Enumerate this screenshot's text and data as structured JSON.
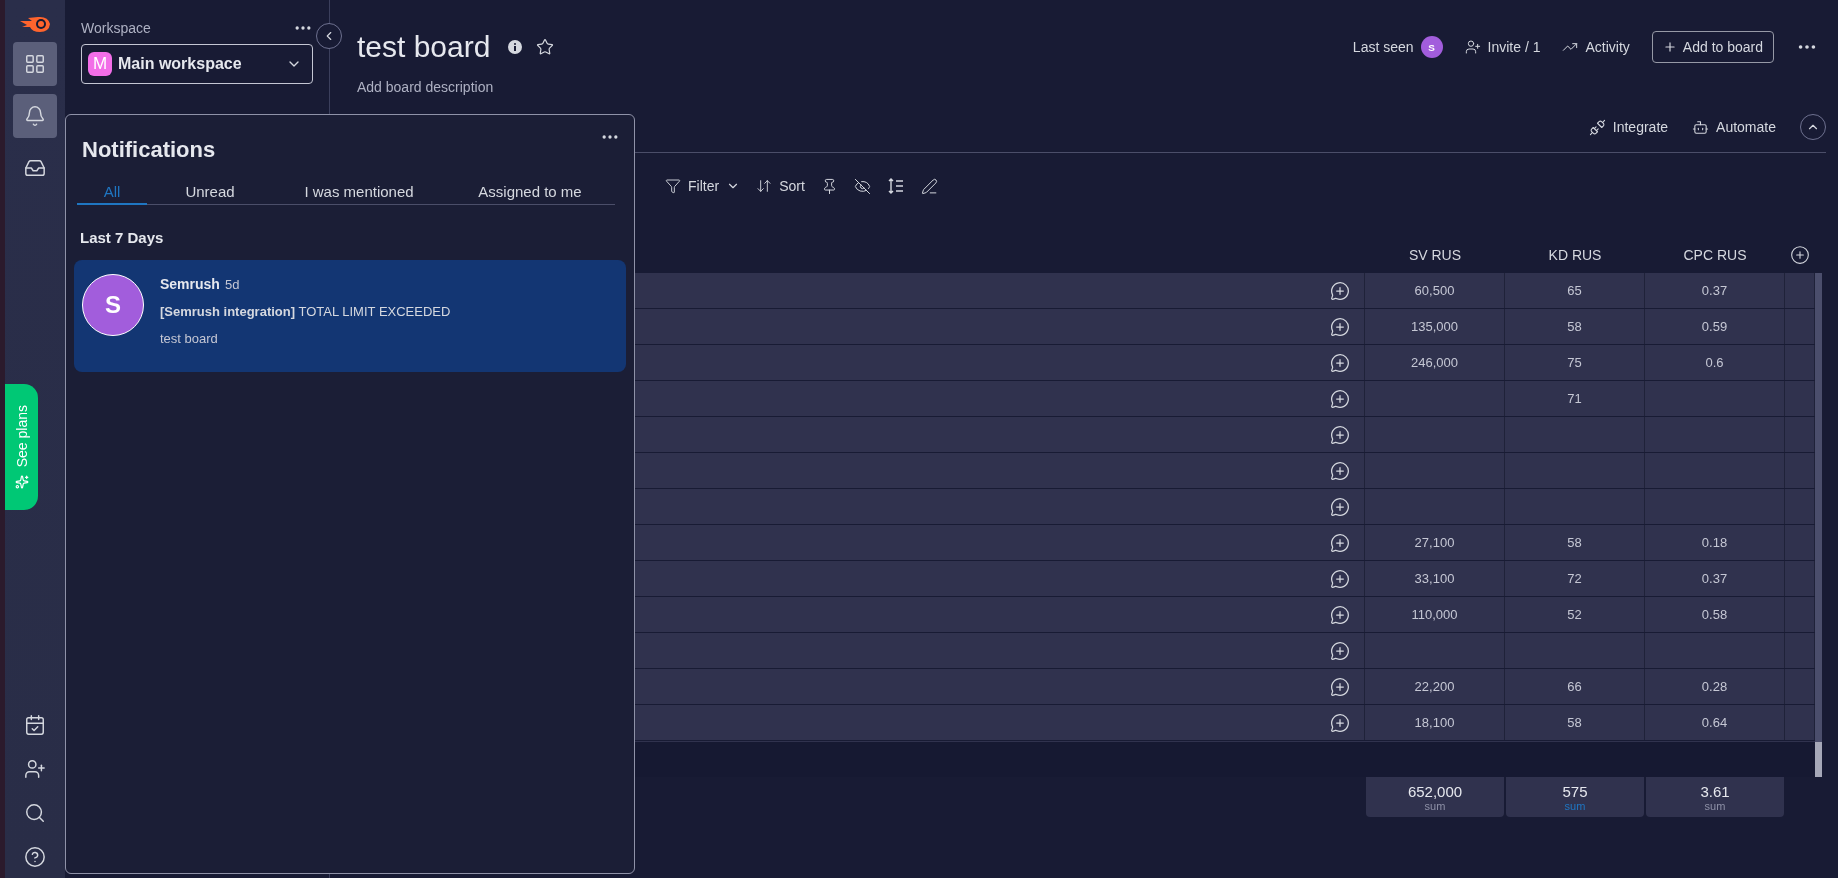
{
  "rail": {
    "items": [
      {
        "selected": true
      },
      {
        "selected": true
      },
      {
        "selected": false
      }
    ],
    "promo": "See plans"
  },
  "workspace": {
    "label": "Workspace",
    "avatar_letter": "M",
    "name": "Main workspace"
  },
  "board": {
    "title": "test board",
    "description": "Add board description"
  },
  "header_actions": {
    "last_seen": "Last seen",
    "avatar_letter": "S",
    "invite": "Invite / 1",
    "activity": "Activity",
    "add": "Add to board"
  },
  "board_actions": [
    "Integrate",
    "Automate"
  ],
  "toolbar": [
    "Filter",
    "Sort"
  ],
  "table": {
    "columns": [
      "SV RUS",
      "KD RUS",
      "CPC RUS"
    ],
    "rows": [
      {
        "cells": [
          "60,500",
          "65",
          "0.37"
        ]
      },
      {
        "cells": [
          "135,000",
          "58",
          "0.59"
        ]
      },
      {
        "cells": [
          "246,000",
          "75",
          "0.6"
        ]
      },
      {
        "cells": [
          null,
          "71",
          null
        ]
      },
      {
        "cells": [
          null,
          null,
          null
        ]
      },
      {
        "cells": [
          null,
          null,
          null
        ]
      },
      {
        "cells": [
          null,
          null,
          null
        ]
      },
      {
        "cells": [
          "27,100",
          "58",
          "0.18"
        ]
      },
      {
        "cells": [
          "33,100",
          "72",
          "0.37"
        ]
      },
      {
        "cells": [
          "110,000",
          "52",
          "0.58"
        ]
      },
      {
        "cells": [
          null,
          null,
          null
        ]
      },
      {
        "cells": [
          "22,200",
          "66",
          "0.28"
        ]
      },
      {
        "cells": [
          "18,100",
          "58",
          "0.64"
        ]
      }
    ],
    "sums": [
      {
        "value": "652,000",
        "label": "sum",
        "highlighted": false
      },
      {
        "value": "575",
        "label": "sum",
        "highlighted": true
      },
      {
        "value": "3.61",
        "label": "sum",
        "highlighted": false
      }
    ]
  },
  "notifications": {
    "title": "Notifications",
    "tabs": [
      {
        "label": "All",
        "selected": true
      },
      {
        "label": "Unread",
        "selected": false
      },
      {
        "label": "I was mentioned",
        "selected": false
      },
      {
        "label": "Assigned to me",
        "selected": false
      }
    ],
    "section": "Last 7 Days",
    "items": [
      {
        "avatar_letter": "S",
        "sender": "Semrush",
        "time": "5d",
        "message": "**[Semrush integration]** TOTAL LIMIT EXCEEDED",
        "board": "test board",
        "unread": true
      }
    ]
  }
}
